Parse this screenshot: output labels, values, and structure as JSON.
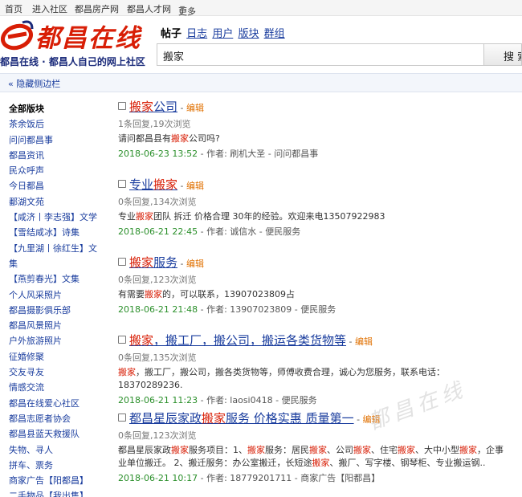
{
  "topbar": {
    "items": [
      "首页",
      "进入社区",
      "都昌房产网",
      "都昌人才网",
      "更多"
    ]
  },
  "logo": {
    "text": "都昌在线",
    "slogan": "都昌在线 · 都昌人自己的网上社区"
  },
  "search": {
    "tabs": [
      "帖子",
      "日志",
      "用户",
      "版块",
      "群组"
    ],
    "active_tab": "帖子",
    "query": "搬家",
    "button_label": "搜 索"
  },
  "collapse_label": "« 隐藏侧边栏",
  "sidebar": {
    "title": "全部版块",
    "items": [
      "茶余饭后",
      "问问都昌事",
      "都昌资讯",
      "民众呼声",
      "今日都昌",
      "鄱湖文苑",
      "【咸济丨李志强】文学",
      "【雪结咸冰】诗集",
      "【九里湖丨徐红生】文集",
      "【燕剪春光】文集",
      "个人风采照片",
      "都昌摄影俱乐部",
      "都昌风景照片",
      "户外旅游照片",
      "征婚修聚",
      "交友寻友",
      "情感交流",
      "都昌在线爱心社区",
      "都昌志愿者协会",
      "都昌县蓝天救援队",
      "失物、寻人",
      "拼车、票务",
      "商家广告【阳都昌】",
      "二手物品【我出售】"
    ]
  },
  "threads": [
    {
      "title_parts": [
        {
          "t": "搬家",
          "hl": true
        },
        {
          "t": "公司",
          "hl": false
        }
      ],
      "edit": "编辑",
      "stats": "1条回复,19次浏览",
      "snippet_parts": [
        {
          "t": "请问都昌县有",
          "hl": false
        },
        {
          "t": "搬家",
          "hl": true
        },
        {
          "t": "公司吗?",
          "hl": false
        }
      ],
      "date": "2018-06-23 13:52",
      "author": "刷机大圣",
      "forum": "问问都昌事"
    },
    {
      "title_parts": [
        {
          "t": "专业",
          "hl": false
        },
        {
          "t": "搬家",
          "hl": true
        }
      ],
      "edit": "编辑",
      "stats": "0条回复,134次浏览",
      "snippet_parts": [
        {
          "t": " 专业",
          "hl": false
        },
        {
          "t": "搬家",
          "hl": true
        },
        {
          "t": "团队 拆迁 价格合理 30年的经验。欢迎来电13507922983",
          "hl": false
        }
      ],
      "date": "2018-06-21 22:45",
      "author": "诚信水",
      "forum": "便民服务"
    },
    {
      "title_parts": [
        {
          "t": "搬家",
          "hl": true
        },
        {
          "t": "服务",
          "hl": false
        }
      ],
      "edit": "编辑",
      "stats": "0条回复,123次浏览",
      "snippet_parts": [
        {
          "t": "有需要",
          "hl": false
        },
        {
          "t": "搬家",
          "hl": true
        },
        {
          "t": "的，可以联系，13907023809占",
          "hl": false
        }
      ],
      "date": "2018-06-21 21:48",
      "author": "13907023809",
      "forum": "便民服务"
    },
    {
      "title_parts": [
        {
          "t": "搬家",
          "hl": true
        },
        {
          "t": "，搬工厂，搬公司，搬运各类货物等",
          "hl": false
        }
      ],
      "edit": "编辑",
      "stats": "0条回复,135次浏览",
      "snippet_parts": [
        {
          "t": "搬家",
          "hl": true
        },
        {
          "t": "，搬工厂，搬公司，搬各类货物等，师傅收费合理，诚心为您服务，联系电话：18370289236.",
          "hl": false
        }
      ],
      "date": "2018-06-21 11:23",
      "author": "laosi0418",
      "forum": "便民服务"
    },
    {
      "title_parts": [
        {
          "t": "都昌星辰家政",
          "hl": false
        },
        {
          "t": "搬家",
          "hl": true
        },
        {
          "t": "服务 价格实惠 质量第一",
          "hl": false
        }
      ],
      "edit": "编辑",
      "stats": "0条回复,123次浏览",
      "snippet_parts": [
        {
          "t": "都昌星辰家政",
          "hl": false
        },
        {
          "t": "搬家",
          "hl": true
        },
        {
          "t": "服务项目：1、",
          "hl": false
        },
        {
          "t": "搬家",
          "hl": true
        },
        {
          "t": "服务：居民",
          "hl": false
        },
        {
          "t": "搬家",
          "hl": true
        },
        {
          "t": "、公司",
          "hl": false
        },
        {
          "t": "搬家",
          "hl": true
        },
        {
          "t": "、住宅",
          "hl": false
        },
        {
          "t": "搬家",
          "hl": true
        },
        {
          "t": "、大中小型",
          "hl": false
        },
        {
          "t": "搬家",
          "hl": true
        },
        {
          "t": "，企事业单位搬迁。 2、搬迁服务：办公室搬迁，长短途",
          "hl": false
        },
        {
          "t": "搬家",
          "hl": true
        },
        {
          "t": "、搬厂、写字楼、钢琴柜、专业搬运钢..",
          "hl": false
        }
      ],
      "date": "2018-06-21 10:17",
      "author": "18779201711",
      "forum": "商家广告【阳都昌】"
    }
  ],
  "labels": {
    "author_prefix": "作者:",
    "separator": " - "
  },
  "watermark": "都昌在线",
  "colors": {
    "accent_red": "#d81e06",
    "link_blue": "#1a3d9e",
    "date_green": "#2a8f2a",
    "edit_orange": "#e07000"
  }
}
